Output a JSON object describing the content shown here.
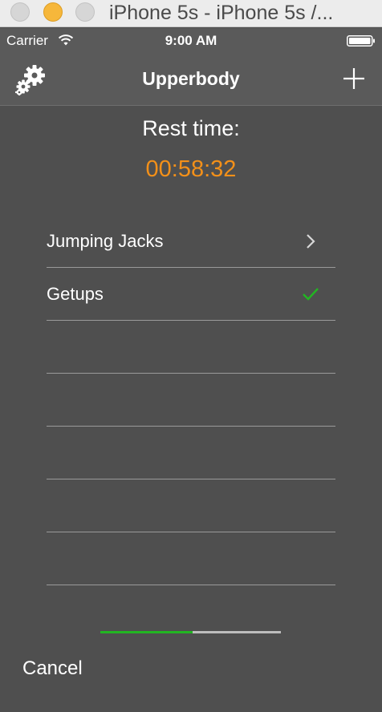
{
  "window": {
    "title": "iPhone 5s - iPhone 5s /..."
  },
  "status_bar": {
    "carrier": "Carrier",
    "time": "9:00 AM"
  },
  "nav": {
    "title": "Upperbody",
    "left_icon": "gears-icon",
    "right_icon": "plus-icon"
  },
  "rest": {
    "label": "Rest time:",
    "time": "00:58:32",
    "time_color": "#f39019"
  },
  "exercises": [
    {
      "label": "Jumping Jacks",
      "accessory": "chevron-right-icon"
    },
    {
      "label": "Getups",
      "accessory": "checkmark-icon"
    },
    {
      "label": "",
      "accessory": ""
    },
    {
      "label": "",
      "accessory": ""
    },
    {
      "label": "",
      "accessory": ""
    },
    {
      "label": "",
      "accessory": ""
    },
    {
      "label": "",
      "accessory": ""
    }
  ],
  "progress": {
    "fraction": 0.51,
    "fill_color": "#22b522"
  },
  "footer": {
    "cancel_label": "Cancel"
  }
}
